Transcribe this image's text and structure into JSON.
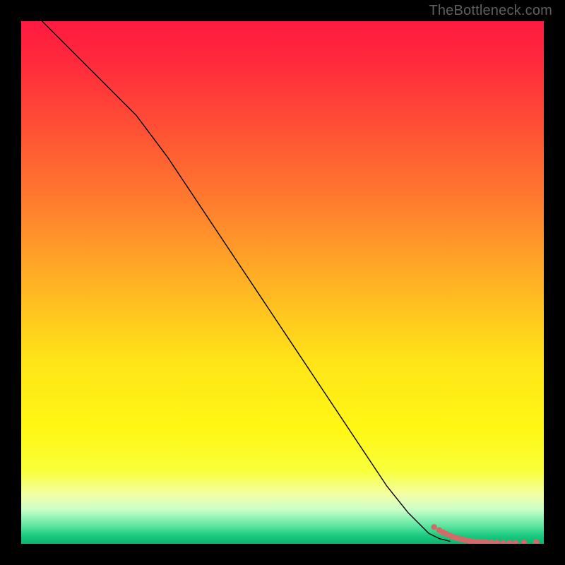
{
  "watermark": "TheBottleneck.com",
  "chart_data": {
    "type": "line",
    "title": "",
    "xlabel": "",
    "ylabel": "",
    "xlim": [
      0,
      100
    ],
    "ylim": [
      0,
      100
    ],
    "grid": false,
    "legend": false,
    "background_gradient": {
      "stops": [
        {
          "offset": 0.0,
          "color": "#ff1a40"
        },
        {
          "offset": 0.08,
          "color": "#ff2a3c"
        },
        {
          "offset": 0.2,
          "color": "#ff4f35"
        },
        {
          "offset": 0.35,
          "color": "#ff7d2e"
        },
        {
          "offset": 0.5,
          "color": "#ffb224"
        },
        {
          "offset": 0.65,
          "color": "#ffe418"
        },
        {
          "offset": 0.78,
          "color": "#fff714"
        },
        {
          "offset": 0.86,
          "color": "#f9ff3a"
        },
        {
          "offset": 0.905,
          "color": "#f4ffa6"
        },
        {
          "offset": 0.935,
          "color": "#c8ffc8"
        },
        {
          "offset": 0.965,
          "color": "#5fe6a2"
        },
        {
          "offset": 0.985,
          "color": "#18c97e"
        },
        {
          "offset": 1.0,
          "color": "#0fb46e"
        }
      ]
    },
    "series": [
      {
        "name": "bottleneck-curve",
        "type": "line",
        "color": "#000000",
        "width": 1.4,
        "x": [
          4,
          10,
          16,
          22,
          28,
          34,
          40,
          46,
          52,
          58,
          64,
          70,
          74,
          78,
          80,
          82
        ],
        "y": [
          100,
          94,
          88,
          82,
          74,
          65,
          56,
          47,
          38,
          29,
          20,
          11,
          6,
          2,
          1,
          0.5
        ]
      },
      {
        "name": "optimal-zone-points",
        "type": "scatter",
        "color": "#d26a6a",
        "radius": 4.2,
        "x": [
          79,
          80,
          80.7,
          81.3,
          82,
          82.6,
          83.2,
          83.8,
          84.4,
          85,
          85.8,
          86.6,
          87.4,
          88.2,
          89,
          90,
          91,
          92.2,
          93.4,
          94.6,
          96.2,
          98.5
        ],
        "y": [
          3.2,
          2.6,
          2.2,
          1.9,
          1.6,
          1.35,
          1.15,
          1.0,
          0.85,
          0.7,
          0.55,
          0.45,
          0.4,
          0.35,
          0.3,
          0.25,
          0.22,
          0.2,
          0.2,
          0.2,
          0.25,
          0.35
        ]
      }
    ]
  }
}
